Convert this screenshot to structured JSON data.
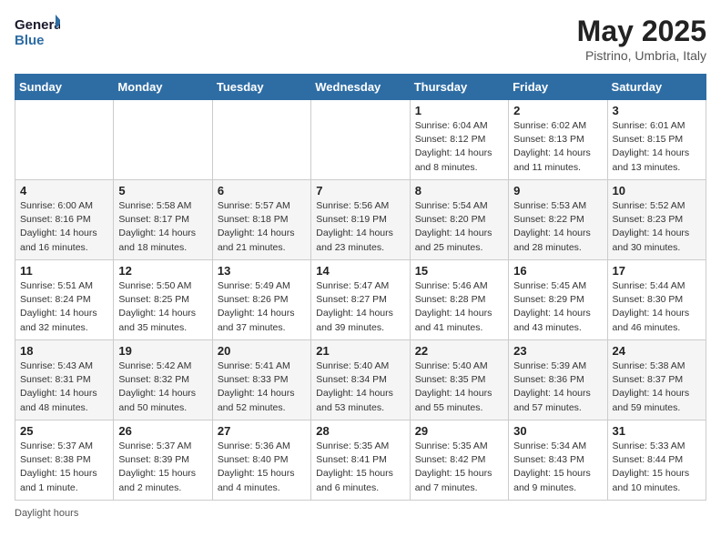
{
  "header": {
    "logo_line1": "General",
    "logo_line2": "Blue",
    "month_year": "May 2025",
    "location": "Pistrino, Umbria, Italy"
  },
  "days_of_week": [
    "Sunday",
    "Monday",
    "Tuesday",
    "Wednesday",
    "Thursday",
    "Friday",
    "Saturday"
  ],
  "weeks": [
    [
      {
        "num": "",
        "info": ""
      },
      {
        "num": "",
        "info": ""
      },
      {
        "num": "",
        "info": ""
      },
      {
        "num": "",
        "info": ""
      },
      {
        "num": "1",
        "info": "Sunrise: 6:04 AM\nSunset: 8:12 PM\nDaylight: 14 hours\nand 8 minutes."
      },
      {
        "num": "2",
        "info": "Sunrise: 6:02 AM\nSunset: 8:13 PM\nDaylight: 14 hours\nand 11 minutes."
      },
      {
        "num": "3",
        "info": "Sunrise: 6:01 AM\nSunset: 8:15 PM\nDaylight: 14 hours\nand 13 minutes."
      }
    ],
    [
      {
        "num": "4",
        "info": "Sunrise: 6:00 AM\nSunset: 8:16 PM\nDaylight: 14 hours\nand 16 minutes."
      },
      {
        "num": "5",
        "info": "Sunrise: 5:58 AM\nSunset: 8:17 PM\nDaylight: 14 hours\nand 18 minutes."
      },
      {
        "num": "6",
        "info": "Sunrise: 5:57 AM\nSunset: 8:18 PM\nDaylight: 14 hours\nand 21 minutes."
      },
      {
        "num": "7",
        "info": "Sunrise: 5:56 AM\nSunset: 8:19 PM\nDaylight: 14 hours\nand 23 minutes."
      },
      {
        "num": "8",
        "info": "Sunrise: 5:54 AM\nSunset: 8:20 PM\nDaylight: 14 hours\nand 25 minutes."
      },
      {
        "num": "9",
        "info": "Sunrise: 5:53 AM\nSunset: 8:22 PM\nDaylight: 14 hours\nand 28 minutes."
      },
      {
        "num": "10",
        "info": "Sunrise: 5:52 AM\nSunset: 8:23 PM\nDaylight: 14 hours\nand 30 minutes."
      }
    ],
    [
      {
        "num": "11",
        "info": "Sunrise: 5:51 AM\nSunset: 8:24 PM\nDaylight: 14 hours\nand 32 minutes."
      },
      {
        "num": "12",
        "info": "Sunrise: 5:50 AM\nSunset: 8:25 PM\nDaylight: 14 hours\nand 35 minutes."
      },
      {
        "num": "13",
        "info": "Sunrise: 5:49 AM\nSunset: 8:26 PM\nDaylight: 14 hours\nand 37 minutes."
      },
      {
        "num": "14",
        "info": "Sunrise: 5:47 AM\nSunset: 8:27 PM\nDaylight: 14 hours\nand 39 minutes."
      },
      {
        "num": "15",
        "info": "Sunrise: 5:46 AM\nSunset: 8:28 PM\nDaylight: 14 hours\nand 41 minutes."
      },
      {
        "num": "16",
        "info": "Sunrise: 5:45 AM\nSunset: 8:29 PM\nDaylight: 14 hours\nand 43 minutes."
      },
      {
        "num": "17",
        "info": "Sunrise: 5:44 AM\nSunset: 8:30 PM\nDaylight: 14 hours\nand 46 minutes."
      }
    ],
    [
      {
        "num": "18",
        "info": "Sunrise: 5:43 AM\nSunset: 8:31 PM\nDaylight: 14 hours\nand 48 minutes."
      },
      {
        "num": "19",
        "info": "Sunrise: 5:42 AM\nSunset: 8:32 PM\nDaylight: 14 hours\nand 50 minutes."
      },
      {
        "num": "20",
        "info": "Sunrise: 5:41 AM\nSunset: 8:33 PM\nDaylight: 14 hours\nand 52 minutes."
      },
      {
        "num": "21",
        "info": "Sunrise: 5:40 AM\nSunset: 8:34 PM\nDaylight: 14 hours\nand 53 minutes."
      },
      {
        "num": "22",
        "info": "Sunrise: 5:40 AM\nSunset: 8:35 PM\nDaylight: 14 hours\nand 55 minutes."
      },
      {
        "num": "23",
        "info": "Sunrise: 5:39 AM\nSunset: 8:36 PM\nDaylight: 14 hours\nand 57 minutes."
      },
      {
        "num": "24",
        "info": "Sunrise: 5:38 AM\nSunset: 8:37 PM\nDaylight: 14 hours\nand 59 minutes."
      }
    ],
    [
      {
        "num": "25",
        "info": "Sunrise: 5:37 AM\nSunset: 8:38 PM\nDaylight: 15 hours\nand 1 minute."
      },
      {
        "num": "26",
        "info": "Sunrise: 5:37 AM\nSunset: 8:39 PM\nDaylight: 15 hours\nand 2 minutes."
      },
      {
        "num": "27",
        "info": "Sunrise: 5:36 AM\nSunset: 8:40 PM\nDaylight: 15 hours\nand 4 minutes."
      },
      {
        "num": "28",
        "info": "Sunrise: 5:35 AM\nSunset: 8:41 PM\nDaylight: 15 hours\nand 6 minutes."
      },
      {
        "num": "29",
        "info": "Sunrise: 5:35 AM\nSunset: 8:42 PM\nDaylight: 15 hours\nand 7 minutes."
      },
      {
        "num": "30",
        "info": "Sunrise: 5:34 AM\nSunset: 8:43 PM\nDaylight: 15 hours\nand 9 minutes."
      },
      {
        "num": "31",
        "info": "Sunrise: 5:33 AM\nSunset: 8:44 PM\nDaylight: 15 hours\nand 10 minutes."
      }
    ]
  ],
  "footer": {
    "daylight_label": "Daylight hours"
  }
}
